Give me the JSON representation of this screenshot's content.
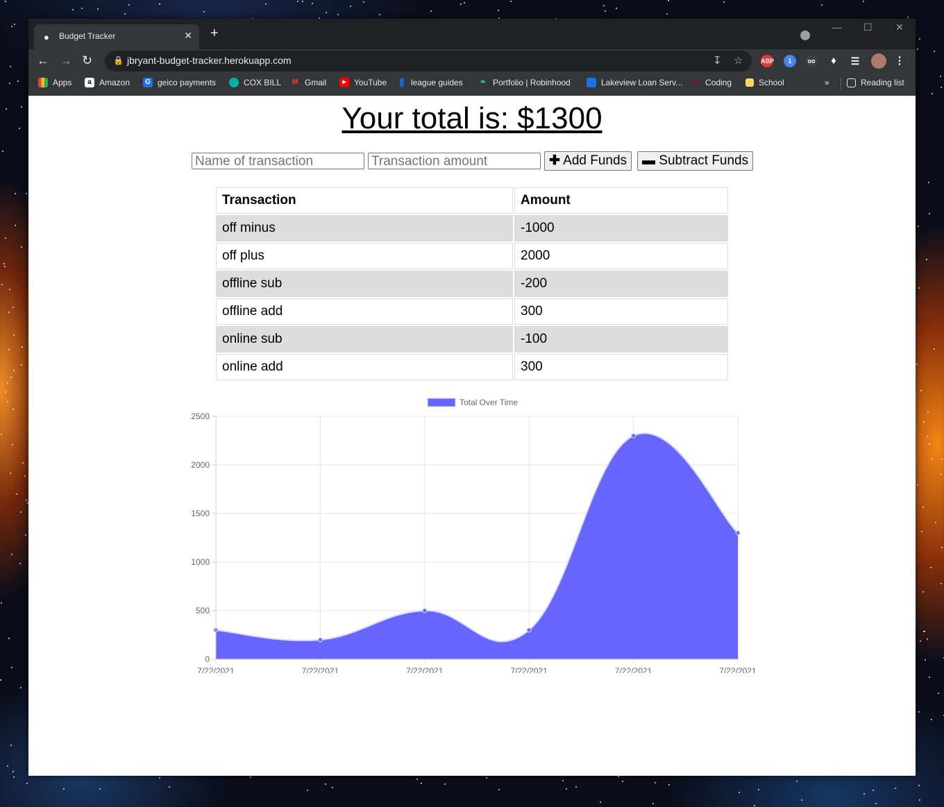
{
  "browser": {
    "tab_title": "Budget Tracker",
    "url": "jbryant-budget-tracker.herokuapp.com",
    "bookmarks": [
      {
        "label": "Apps",
        "icon": "apps-grid-icon",
        "color": "#ea4335"
      },
      {
        "label": "Amazon",
        "icon": "amazon-icon",
        "color": "#ffffff"
      },
      {
        "label": "geico payments",
        "icon": "geico-icon",
        "color": "#1a73e8"
      },
      {
        "label": "COX BILL",
        "icon": "cox-icon",
        "color": "#00b2a9"
      },
      {
        "label": "Gmail",
        "icon": "gmail-icon",
        "color": "#ea4335"
      },
      {
        "label": "YouTube",
        "icon": "youtube-icon",
        "color": "#ff0000"
      },
      {
        "label": "league guides",
        "icon": "league-icon",
        "color": "#1565c0"
      },
      {
        "label": "Portfolio | Robinhood",
        "icon": "robinhood-icon",
        "color": "#21ce99"
      },
      {
        "label": "Lakeview Loan Serv...",
        "icon": "lakeview-icon",
        "color": "#1a73e8"
      },
      {
        "label": "Coding",
        "icon": "arizona-icon",
        "color": "#ab0520"
      },
      {
        "label": "School",
        "icon": "folder-icon",
        "color": "#fdd663"
      }
    ],
    "reading_list": "Reading list",
    "ext_badge": "1",
    "ext_abp": "ABP"
  },
  "page": {
    "title": "Your total is: $1300",
    "name_placeholder": "Name of transaction",
    "amount_placeholder": "Transaction amount",
    "add_label": "Add Funds",
    "subtract_label": "Subtract Funds"
  },
  "table": {
    "headers": [
      "Transaction",
      "Amount"
    ],
    "rows": [
      [
        "off minus",
        "-1000"
      ],
      [
        "off plus",
        "2000"
      ],
      [
        "offline sub",
        "-200"
      ],
      [
        "offline add",
        "300"
      ],
      [
        "online sub",
        "-100"
      ],
      [
        "online add",
        "300"
      ]
    ]
  },
  "chart_data": {
    "type": "area",
    "x": [
      "7/22/2021",
      "7/22/2021",
      "7/22/2021",
      "7/22/2021",
      "7/22/2021",
      "7/22/2021"
    ],
    "series": [
      {
        "name": "Total Over Time",
        "values": [
          300,
          200,
          500,
          300,
          2300,
          1300
        ],
        "color": "#6666ff"
      }
    ],
    "ylim": [
      0,
      2500
    ],
    "yticks": [
      0,
      500,
      1000,
      1500,
      2000,
      2500
    ],
    "grid": true,
    "legend": "top"
  }
}
